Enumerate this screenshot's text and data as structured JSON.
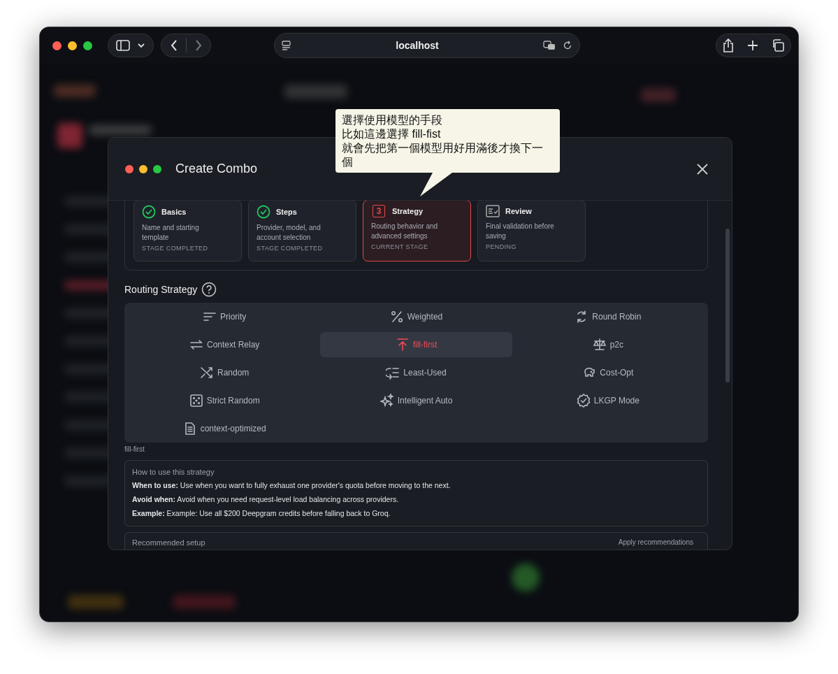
{
  "browser": {
    "address": "localhost"
  },
  "modal": {
    "title": "Create Combo"
  },
  "tooltip": {
    "lines": [
      "選擇使用模型的手段",
      "比如這邊選擇 fill-fist",
      "就會先把第一個模型用好用滿後才換下一個"
    ]
  },
  "stages": [
    {
      "title": "Basics",
      "description": "Name and starting template",
      "status_text": "STAGE COMPLETED",
      "completed": true,
      "current": false
    },
    {
      "title": "Steps",
      "description": "Provider, model, and account selection",
      "status_text": "STAGE COMPLETED",
      "completed": true,
      "current": false
    },
    {
      "title": "Strategy",
      "description": "Routing behavior and advanced settings",
      "status_text": "CURRENT STAGE",
      "completed": false,
      "current": true,
      "badge": "3"
    },
    {
      "title": "Review",
      "description": "Final validation before saving",
      "status_text": "PENDING",
      "completed": false,
      "current": false
    }
  ],
  "routing": {
    "title": "Routing Strategy",
    "options": [
      {
        "label": "Priority",
        "kind": "priority",
        "selected": false
      },
      {
        "label": "Weighted",
        "kind": "weighted",
        "selected": false
      },
      {
        "label": "Round Robin",
        "kind": "round-robin",
        "selected": false
      },
      {
        "label": "Context Relay",
        "kind": "context-relay",
        "selected": false
      },
      {
        "label": "fill-first",
        "kind": "fill-first",
        "selected": true
      },
      {
        "label": "p2c",
        "kind": "p2c",
        "selected": false
      },
      {
        "label": "Random",
        "kind": "random",
        "selected": false
      },
      {
        "label": "Least-Used",
        "kind": "least-used",
        "selected": false
      },
      {
        "label": "Cost-Opt",
        "kind": "cost-opt",
        "selected": false
      },
      {
        "label": "Strict Random",
        "kind": "strict-random",
        "selected": false
      },
      {
        "label": "Intelligent Auto",
        "kind": "intelligent-auto",
        "selected": false
      },
      {
        "label": "LKGP Mode",
        "kind": "lkgp",
        "selected": false
      },
      {
        "label": "context-optimized",
        "kind": "context-optimized",
        "selected": false
      }
    ],
    "selected_caption": "fill-first"
  },
  "guide": {
    "title": "How to use this strategy",
    "lines": [
      "**When to use:** Use when you want to fully exhaust one provider's quota before moving to the next.",
      "**Avoid when:** Avoid when you need request-level load balancing across providers.",
      "**Example:** Example: Use all $200 Deepgram credits before falling back to Groq."
    ]
  },
  "recommended": {
    "title": "Recommended setup",
    "action": "Apply recommendations"
  }
}
